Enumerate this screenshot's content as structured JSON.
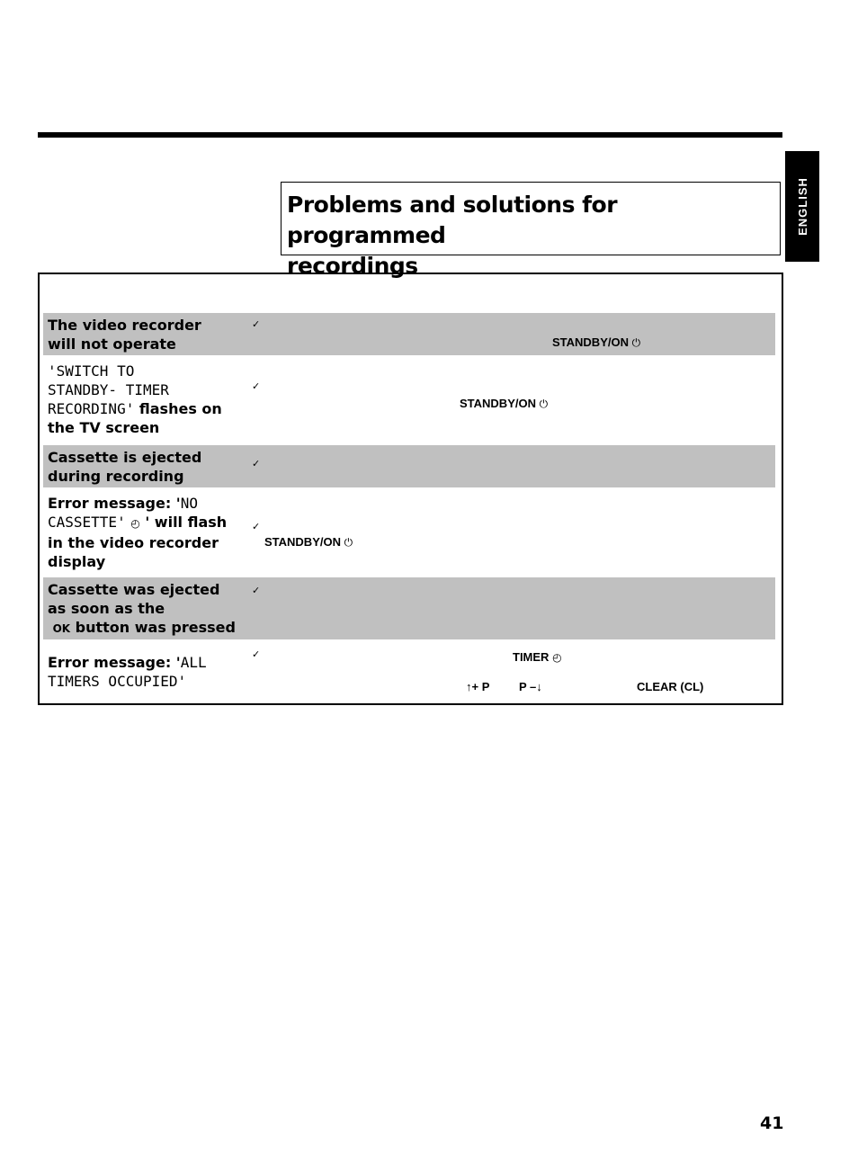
{
  "header": {
    "title_line1": "Problems and solutions for programmed",
    "title_line2": "recordings",
    "language_tab": "ENGLISH"
  },
  "rows": [
    {
      "problem": "The video recorder will not operate",
      "problem_parts": [
        "The video recorder",
        "will not operate"
      ],
      "shaded": true,
      "check": "✓",
      "keys": [
        "STANDBY/ON"
      ]
    },
    {
      "problem_parts": [
        "'SWITCH TO",
        "STANDBY- TIMER",
        "RECORDING'",
        " flashes on",
        "the TV screen"
      ],
      "shaded": false,
      "check": "✓",
      "keys": [
        "STANDBY/ON"
      ]
    },
    {
      "problem_parts": [
        "Cassette is ejected",
        "during recording"
      ],
      "shaded": true,
      "check": "✓",
      "keys": []
    },
    {
      "problem_parts": [
        "Error message: '",
        "NO",
        "CASSETTE'",
        " ' will flash",
        "in the video recorder",
        "display"
      ],
      "shaded": false,
      "check": "✓",
      "keys": [
        "STANDBY/ON"
      ]
    },
    {
      "problem_parts": [
        "Cassette was ejected",
        "as soon as the",
        "OK",
        " button was pressed"
      ],
      "shaded": true,
      "check": "✓",
      "keys": []
    },
    {
      "problem_parts": [
        "Error message: '",
        "ALL",
        "TIMERS OCCUPIED'"
      ],
      "shaded": false,
      "check": "✓",
      "keys": [
        "TIMER",
        "↑+ P",
        "P –↓",
        "CLEAR (CL)"
      ]
    }
  ],
  "icons": {
    "power": "⏻",
    "timer": "◴"
  },
  "footer": {
    "page_number": "41"
  }
}
